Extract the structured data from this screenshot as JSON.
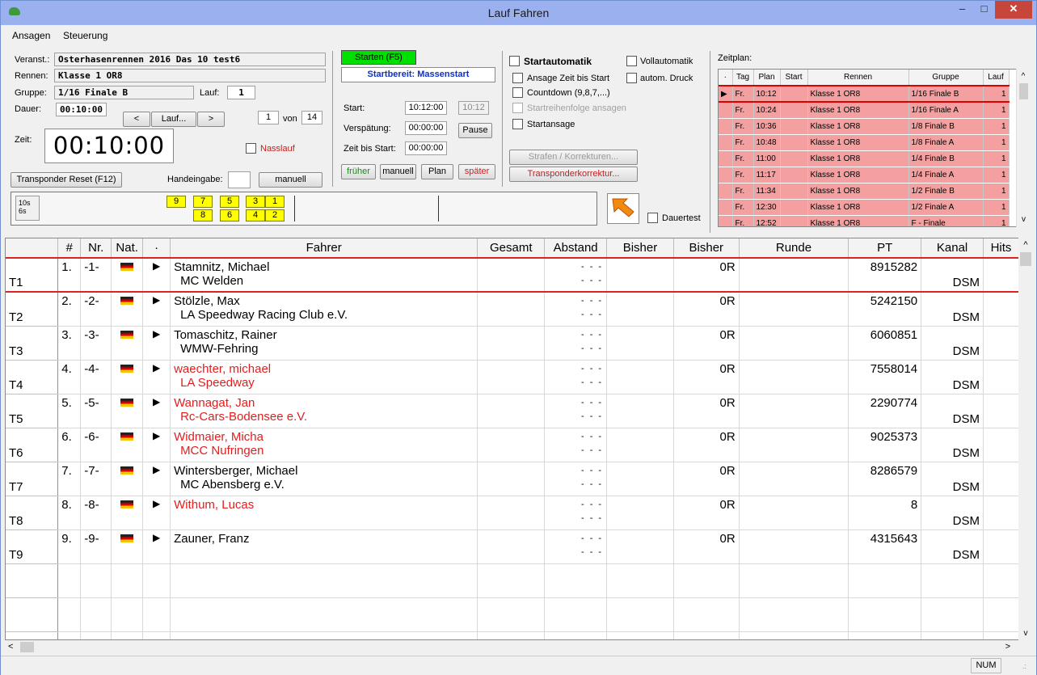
{
  "window": {
    "title": "Lauf Fahren",
    "minimize": "–",
    "maximize": "□",
    "close": "✕"
  },
  "menu": [
    "Ansagen",
    "Steuerung"
  ],
  "event": {
    "veranst_label": "Veranst.:",
    "veranst": "Osterhasenrennen 2016 Das 10 test6",
    "rennen_label": "Rennen:",
    "rennen": "Klasse 1 OR8",
    "gruppe_label": "Gruppe:",
    "gruppe": "1/16 Finale B",
    "lauf_label": "Lauf:",
    "lauf": "1",
    "dauer_label": "Dauer:",
    "dauer": "00:10:00",
    "prev": "<",
    "lauf_btn": "Lauf...",
    "next": ">",
    "lauf_num": "1",
    "von": "von",
    "lauf_total": "14",
    "zeit_label": "Zeit:",
    "zeit": "00:10:00",
    "nasslauf": "Nasslauf",
    "transponder_reset": "Transponder Reset (F12)",
    "handeingabe": "Handeingabe:",
    "manuell": "manuell"
  },
  "start": {
    "starten": "Starten (F5)",
    "startbereit": "Startbereit: Massenstart",
    "start_label": "Start:",
    "start": "10:12:00",
    "start_small": "10:12",
    "verspaetung_label": "Verspätung:",
    "verspaetung": "00:00:00",
    "pause": "Pause",
    "zeit_bis_label": "Zeit bis Start:",
    "zeit_bis": "00:00:00",
    "frueher": "früher",
    "manuell": "manuell",
    "plan": "Plan",
    "spaeter": "später"
  },
  "options": {
    "startautomatik": "Startautomatik",
    "vollautomatik": "Vollautomatik",
    "ansage": "Ansage Zeit bis Start",
    "autom_druck": "autom. Druck",
    "countdown": "Countdown (9,8,7,...)",
    "reihenfolge": "Startreihenfolge ansagen",
    "startansage": "Startansage",
    "strafen": "Strafen / Korrekturen...",
    "transponderkorrektur": "Transponderkorrektur...",
    "dauertest": "Dauertest"
  },
  "lanes": {
    "l1": "10s",
    "l2": "6s",
    "top": [
      "9",
      "7",
      "5",
      "3",
      "1"
    ],
    "bottom": [
      "8",
      "6",
      "4",
      "2"
    ]
  },
  "zeitplan": {
    "label": "Zeitplan:",
    "headers": [
      "·",
      "Tag",
      "Plan",
      "Start",
      "Rennen",
      "Gruppe",
      "Lauf"
    ],
    "rows": [
      {
        "m": "▶",
        "tag": "Fr.",
        "plan": "10:12",
        "start": "",
        "rennen": "Klasse 1 OR8",
        "gruppe": "1/16 Finale B",
        "lauf": "1"
      },
      {
        "m": "",
        "tag": "Fr.",
        "plan": "10:24",
        "start": "",
        "rennen": "Klasse 1 OR8",
        "gruppe": "1/16 Finale A",
        "lauf": "1"
      },
      {
        "m": "",
        "tag": "Fr.",
        "plan": "10:36",
        "start": "",
        "rennen": "Klasse 1 OR8",
        "gruppe": "1/8 Finale B",
        "lauf": "1"
      },
      {
        "m": "",
        "tag": "Fr.",
        "plan": "10:48",
        "start": "",
        "rennen": "Klasse 1 OR8",
        "gruppe": "1/8 Finale A",
        "lauf": "1"
      },
      {
        "m": "",
        "tag": "Fr.",
        "plan": "11:00",
        "start": "",
        "rennen": "Klasse 1 OR8",
        "gruppe": "1/4 Finale B",
        "lauf": "1"
      },
      {
        "m": "",
        "tag": "Fr.",
        "plan": "11:17",
        "start": "",
        "rennen": "Klasse 1 OR8",
        "gruppe": "1/4 Finale A",
        "lauf": "1"
      },
      {
        "m": "",
        "tag": "Fr.",
        "plan": "11:34",
        "start": "",
        "rennen": "Klasse 1 OR8",
        "gruppe": "1/2 Finale B",
        "lauf": "1"
      },
      {
        "m": "",
        "tag": "Fr.",
        "plan": "12:30",
        "start": "",
        "rennen": "Klasse 1 OR8",
        "gruppe": "1/2 Finale A",
        "lauf": "1"
      },
      {
        "m": "",
        "tag": "Fr.",
        "plan": "12:52",
        "start": "",
        "rennen": "Klasse 1 OR8",
        "gruppe": "F - Finale",
        "lauf": "1"
      }
    ]
  },
  "grid": {
    "headers": [
      "",
      "#",
      "Nr.",
      "Nat.",
      "·",
      "Fahrer",
      "Gesamt",
      "Abstand",
      "Bisher",
      "Bisher",
      "Runde",
      "PT",
      "Kanal",
      "Hits"
    ],
    "rows": [
      {
        "t": "T1",
        "pos": "1.",
        "nr": "-1-",
        "name": "Stamnitz, Michael",
        "club": "MC Welden",
        "red": false,
        "bisher": "0R",
        "pt": "8915282",
        "kanal": "DSM"
      },
      {
        "t": "T2",
        "pos": "2.",
        "nr": "-2-",
        "name": "Stölzle, Max",
        "club": "LA Speedway Racing Club e.V.",
        "red": false,
        "bisher": "0R",
        "pt": "5242150",
        "kanal": "DSM"
      },
      {
        "t": "T3",
        "pos": "3.",
        "nr": "-3-",
        "name": "Tomaschitz, Rainer",
        "club": "WMW-Fehring",
        "red": false,
        "bisher": "0R",
        "pt": "6060851",
        "kanal": "DSM"
      },
      {
        "t": "T4",
        "pos": "4.",
        "nr": "-4-",
        "name": "waechter, michael",
        "club": "LA Speedway",
        "red": true,
        "bisher": "0R",
        "pt": "7558014",
        "kanal": "DSM"
      },
      {
        "t": "T5",
        "pos": "5.",
        "nr": "-5-",
        "name": "Wannagat, Jan",
        "club": "Rc-Cars-Bodensee e.V.",
        "red": true,
        "bisher": "0R",
        "pt": "2290774",
        "kanal": "DSM"
      },
      {
        "t": "T6",
        "pos": "6.",
        "nr": "-6-",
        "name": "Widmaier, Micha",
        "club": "MCC Nufringen",
        "red": true,
        "bisher": "0R",
        "pt": "9025373",
        "kanal": "DSM"
      },
      {
        "t": "T7",
        "pos": "7.",
        "nr": "-7-",
        "name": "Wintersberger, Michael",
        "club": "MC Abensberg e.V.",
        "red": false,
        "bisher": "0R",
        "pt": "8286579",
        "kanal": "DSM"
      },
      {
        "t": "T8",
        "pos": "8.",
        "nr": "-8-",
        "name": "Withum, Lucas",
        "club": "",
        "red": true,
        "bisher": "0R",
        "pt": "8",
        "kanal": "DSM"
      },
      {
        "t": "T9",
        "pos": "9.",
        "nr": "-9-",
        "name": "Zauner, Franz",
        "club": "",
        "red": false,
        "bisher": "0R",
        "pt": "4315643",
        "kanal": "DSM"
      }
    ],
    "abstand": "- - -"
  },
  "status": {
    "num": "NUM"
  }
}
